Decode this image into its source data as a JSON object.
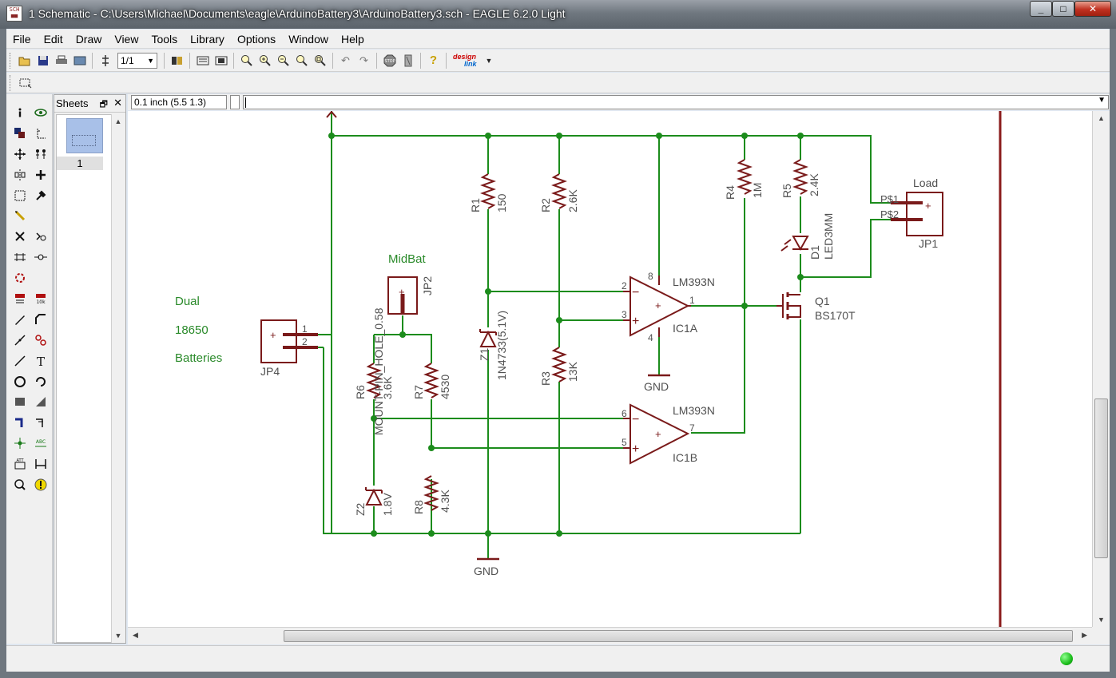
{
  "window": {
    "title": "1 Schematic - C:\\Users\\Michael\\Documents\\eagle\\ArduinoBattery3\\ArduinoBattery3.sch - EAGLE 6.2.0 Light",
    "min": "_",
    "max": "□",
    "close": "✕"
  },
  "menu": [
    "File",
    "Edit",
    "Draw",
    "View",
    "Tools",
    "Library",
    "Options",
    "Window",
    "Help"
  ],
  "toolbar": {
    "sheet_select": "1/1",
    "designlink_a": "design",
    "designlink_b": "link"
  },
  "sheets": {
    "title": "Sheets",
    "items": [
      "1"
    ]
  },
  "coord": "0.1 inch (5.5 1.3)",
  "command": "",
  "colors": {
    "wire": "#1c8c1c",
    "symbol": "#7a1a1a",
    "label": "#505050",
    "text_green": "#2a8a2a",
    "frame": "#8a1a1a"
  },
  "schematic": {
    "notes": [
      "Dual",
      "18650",
      "Batteries",
      "MidBat",
      "Load"
    ],
    "parts": {
      "R1": {
        "name": "R1",
        "value": "150"
      },
      "R2": {
        "name": "R2",
        "value": "2.6K"
      },
      "R3": {
        "name": "R3",
        "value": "13K"
      },
      "R4": {
        "name": "R4",
        "value": "1M"
      },
      "R5": {
        "name": "R5",
        "value": "2.4K"
      },
      "R6": {
        "name": "R6",
        "value": "3.6K"
      },
      "R7": {
        "name": "R7",
        "value": "4530"
      },
      "R8": {
        "name": "R8",
        "value": "4.3K"
      },
      "Z1": {
        "name": "Z1",
        "value": "1N4733(5.1V)"
      },
      "Z2": {
        "name": "Z2",
        "value": "1.8V"
      },
      "D1": {
        "name": "D1",
        "value": "LED3MM"
      },
      "Q1": {
        "name": "Q1",
        "value": "BS170T"
      },
      "IC1A": {
        "name": "IC1A",
        "value": "LM393N"
      },
      "IC1B": {
        "name": "IC1B",
        "value": "LM393N"
      },
      "JP1": {
        "name": "JP1"
      },
      "JP2": {
        "name": "JP2",
        "value": "MOUNT-PIN_HOLE_0.58"
      },
      "JP4": {
        "name": "JP4"
      }
    },
    "gnd": "GND",
    "pins": {
      "jp4_1": "1",
      "jp4_2": "2",
      "jp1_1": "P$1",
      "jp1_2": "P$2",
      "ic1a_in_minus": "2",
      "ic1a_in_plus": "3",
      "ic1a_out": "1",
      "ic1a_vcc": "8",
      "ic1a_gnd": "4",
      "ic1b_in_minus": "6",
      "ic1b_in_plus": "5",
      "ic1b_out": "7"
    },
    "symbols": {
      "minus": "−",
      "plus": "+"
    }
  },
  "icons": {
    "toolbar": [
      "open-icon",
      "save-icon",
      "print-icon",
      "cam-icon",
      "board-switch-icon",
      "library-icon",
      "script-icon",
      "run-ulp-icon",
      "zoom-fit-icon",
      "zoom-in-icon",
      "zoom-out-icon",
      "redraw-icon",
      "zoom-select-icon",
      "undo-icon",
      "redo-icon",
      "stop-icon",
      "go-icon",
      "help-icon"
    ],
    "palette": [
      "info-icon",
      "show-icon",
      "display-icon",
      "mark-icon",
      "move-icon",
      "copy-icon",
      "mirror-icon",
      "rotate-icon",
      "group-icon",
      "change-icon",
      "paste-icon",
      "delete-icon",
      "add-icon",
      "pinswap-icon",
      "replace-icon",
      "gateswap-icon",
      "name-icon",
      "value-icon",
      "smash-icon",
      "miter-icon",
      "split-icon",
      "invoke-icon",
      "wire-icon",
      "text-icon",
      "circle-icon",
      "arc-icon",
      "rect-icon",
      "polygon-icon",
      "bus-icon",
      "net-icon",
      "junction-icon",
      "label-icon",
      "attribute-icon",
      "dimension-icon",
      "erc-icon",
      "errors-icon"
    ]
  }
}
